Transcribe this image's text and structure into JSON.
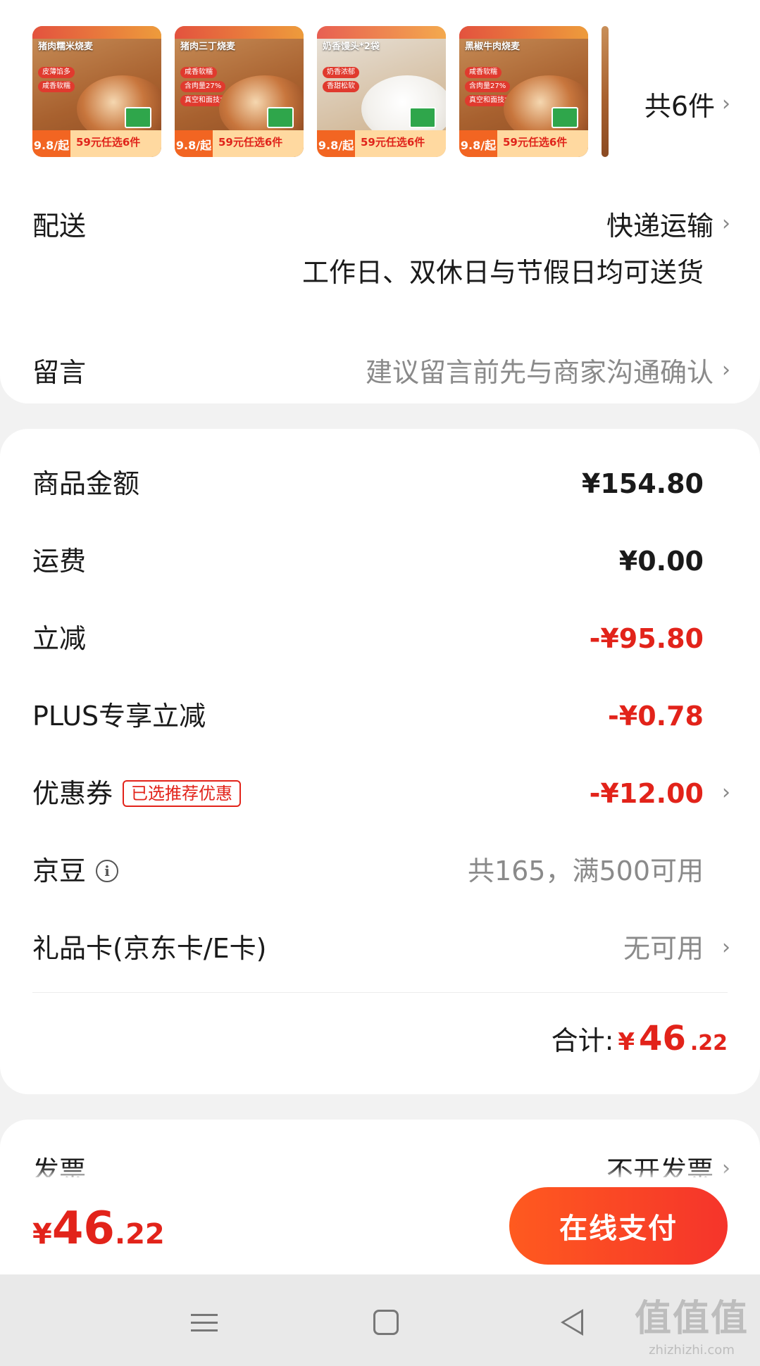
{
  "products": {
    "items": [
      {
        "title": "猪肉糯米烧麦",
        "tags": [
          "皮薄馅多",
          "咸香软糯"
        ],
        "price": "9.8/起",
        "promo": "59元任选6件"
      },
      {
        "title": "猪肉三丁烧麦",
        "tags": [
          "咸香软糯",
          "含肉量27%",
          "真空和面技术"
        ],
        "price": "9.8/起",
        "promo": "59元任选6件"
      },
      {
        "title": "奶香馒头*2袋",
        "tags": [
          "奶香浓郁",
          "香甜松软"
        ],
        "price": "9.8/起",
        "promo": "59元任选6件"
      },
      {
        "title": "黑椒牛肉烧麦",
        "tags": [
          "咸香软糯",
          "含肉量27%",
          "真空和面技术"
        ],
        "price": "9.8/起",
        "promo": "59元任选6件"
      }
    ],
    "count_label": "共6件"
  },
  "delivery": {
    "label": "配送",
    "method": "快递运输",
    "note": "工作日、双休日与节假日均可送货"
  },
  "remark": {
    "label": "留言",
    "placeholder": "建议留言前先与商家沟通确认"
  },
  "pricing": {
    "goods_amount": {
      "label": "商品金额",
      "value": "¥154.80"
    },
    "shipping": {
      "label": "运费",
      "value": "¥0.00"
    },
    "discount": {
      "label": "立减",
      "value": "-¥95.80"
    },
    "plus_discount": {
      "label": "PLUS专享立减",
      "value": "-¥0.78"
    },
    "coupon": {
      "label": "优惠券",
      "tag": "已选推荐优惠",
      "value": "-¥12.00"
    },
    "jingdou": {
      "label": "京豆",
      "value": "共165，满500可用"
    },
    "gift_card": {
      "label": "礼品卡(京东卡/E卡)",
      "value": "无可用"
    },
    "total": {
      "label": "合计:",
      "yen": "¥",
      "int": "46",
      "dec": ".22"
    }
  },
  "invoice": {
    "label": "发票",
    "value": "不开发票"
  },
  "paybar": {
    "yen": "¥",
    "int": "46",
    "dec": ".22",
    "button": "在线支付"
  },
  "watermark": {
    "main": "值值值",
    "sub": "zhizhizhi.com"
  },
  "colors": {
    "accent": "#e2231a",
    "pay_button": "#f5342b"
  }
}
